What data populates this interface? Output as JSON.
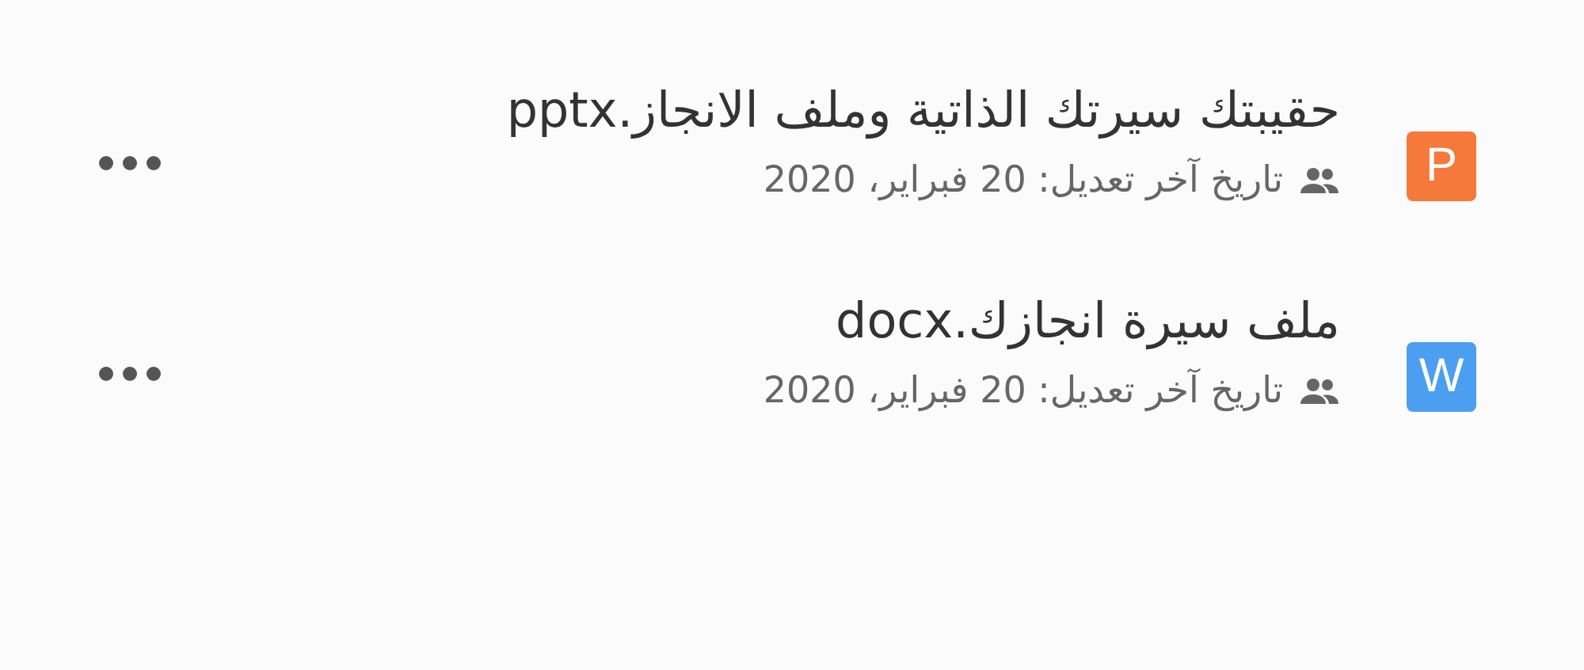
{
  "files": [
    {
      "badge": "P",
      "color": "#f5793a",
      "name": "حقيبتك سيرتك الذاتية وملف الانجاز.pptx",
      "modified": "تاريخ آخر تعديل: 20 فبراير، 2020"
    },
    {
      "badge": "W",
      "color": "#4c9ff0",
      "name": "ملف سيرة انجازك.docx",
      "modified": "تاريخ آخر تعديل: 20 فبراير، 2020"
    }
  ]
}
